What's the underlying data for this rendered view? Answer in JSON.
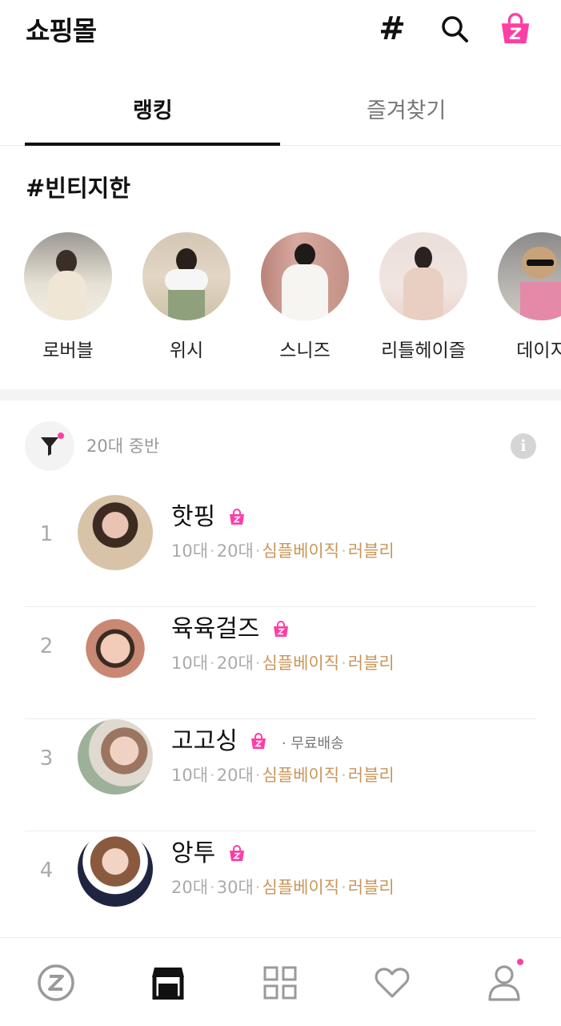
{
  "header": {
    "title": "쇼핑몰",
    "hash_symbol": "#",
    "icons": [
      "hash-icon",
      "search-icon",
      "shopping-bag-icon"
    ],
    "accent_color": "#ff3ea5"
  },
  "tabs": [
    {
      "label": "랭킹",
      "active": true
    },
    {
      "label": "즐겨찾기",
      "active": false
    }
  ],
  "hashtag_section": {
    "title": "#빈티지한",
    "stores": [
      {
        "label": "로버블"
      },
      {
        "label": "위시"
      },
      {
        "label": "스니즈"
      },
      {
        "label": "리틀헤이즐"
      },
      {
        "label": "데이지"
      }
    ]
  },
  "filter": {
    "label": "20대 중반",
    "icon": "filter-icon",
    "info_icon": "info-icon",
    "info_glyph": "i"
  },
  "ranking": [
    {
      "rank": "1",
      "name": "핫핑",
      "free_shipping": "",
      "ages": [
        "10대",
        "20대"
      ],
      "styles": [
        "심플베이직",
        "러블리"
      ]
    },
    {
      "rank": "2",
      "name": "육육걸즈",
      "free_shipping": "",
      "ages": [
        "10대",
        "20대"
      ],
      "styles": [
        "심플베이직",
        "러블리"
      ]
    },
    {
      "rank": "3",
      "name": "고고싱",
      "free_shipping": "· 무료배송",
      "ages": [
        "10대",
        "20대"
      ],
      "styles": [
        "심플베이직",
        "러블리"
      ]
    },
    {
      "rank": "4",
      "name": "앙투",
      "free_shipping": "",
      "ages": [
        "20대",
        "30대"
      ],
      "styles": [
        "심플베이직",
        "러블리"
      ]
    }
  ],
  "bottom_nav": [
    {
      "name": "zigzag-home-icon"
    },
    {
      "name": "store-icon",
      "active": true
    },
    {
      "name": "category-grid-icon"
    },
    {
      "name": "heart-icon"
    },
    {
      "name": "profile-icon",
      "dot": true
    }
  ]
}
